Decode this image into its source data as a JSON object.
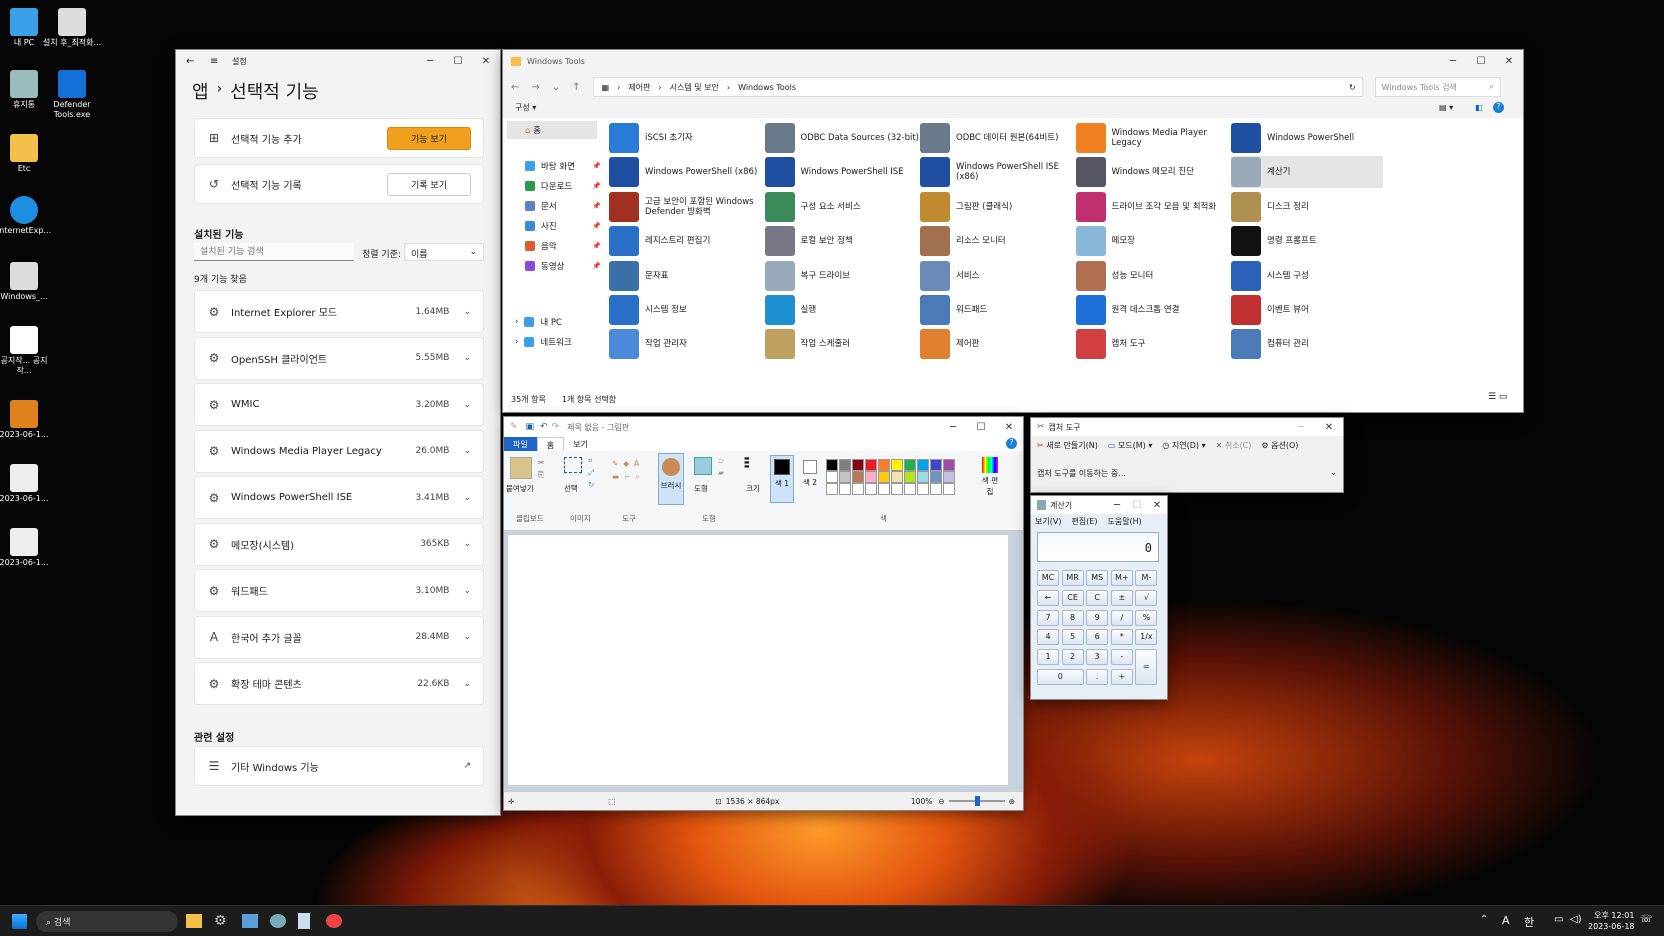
{
  "desktop": {
    "icons": [
      "내 PC",
      "설치 후_최적화...",
      "휴지통",
      "Defender Tools.exe",
      "Etc",
      "InternetExp...",
      "Windows_...",
      "공지작... 공지작...",
      "2023-06-1...",
      "2023-06-1...",
      "2023-06-1..."
    ]
  },
  "settings": {
    "title": "설정",
    "crumb_parent": "앱",
    "crumb_sep": "›",
    "crumb_current": "선택적 기능",
    "add_label": "선택적 기능 추가",
    "add_btn": "기능 보기",
    "history_label": "선택적 기능 기록",
    "history_btn": "기록 보기",
    "installed_heading": "설치된 기능",
    "search_placeholder": "설치된 기능 검색",
    "sort_label": "정렬 기준:",
    "sort_value": "이름",
    "found": "9개 기능 찾음",
    "features": [
      {
        "name": "Internet Explorer 모드",
        "size": "1.64MB"
      },
      {
        "name": "OpenSSH 클라이언트",
        "size": "5.55MB"
      },
      {
        "name": "WMIC",
        "size": "3.20MB"
      },
      {
        "name": "Windows Media Player Legacy",
        "size": "26.0MB"
      },
      {
        "name": "Windows PowerShell ISE",
        "size": "3.41MB"
      },
      {
        "name": "메모장(시스템)",
        "size": "365KB"
      },
      {
        "name": "워드패드",
        "size": "3.10MB"
      },
      {
        "name": "한국어 추가 글꼴",
        "size": "28.4MB"
      },
      {
        "name": "확장 테마 콘텐츠",
        "size": "22.6KB"
      }
    ],
    "related_heading": "관련 설정",
    "related_item": "기타 Windows 기능"
  },
  "explorer": {
    "title": "Windows Tools",
    "path": [
      "제어판",
      "시스템 및 보안",
      "Windows Tools"
    ],
    "search_placeholder": "Windows Tools 검색",
    "organize": "구성 ▾",
    "nav_home": "홈",
    "nav": [
      "바탕 화면",
      "다운로드",
      "문서",
      "사진",
      "음악",
      "동영상"
    ],
    "nav_pc": "내 PC",
    "nav_net": "네트워크",
    "tools": [
      "iSCSI 초기자",
      "ODBC Data Sources (32-bit)",
      "ODBC 데이터 원본(64비트)",
      "Windows Media Player Legacy",
      "Windows PowerShell",
      "Windows PowerShell (x86)",
      "Windows PowerShell ISE",
      "Windows PowerShell ISE (x86)",
      "Windows 메모리 진단",
      "계산기",
      "고급 보안이 포함된 Windows Defender 방화벽",
      "구성 요소 서비스",
      "그림판 (클래식)",
      "드라이브 조각 모음 및 최적화",
      "디스크 정리",
      "레지스트리 편집기",
      "로컬 보안 정책",
      "리소스 모니터",
      "메모장",
      "명령 프롬프트",
      "문자표",
      "복구 드라이브",
      "서비스",
      "성능 모니터",
      "시스템 구성",
      "시스템 정보",
      "실행",
      "워드패드",
      "원격 데스크톱 연결",
      "이벤트 뷰어",
      "작업 관리자",
      "작업 스케줄러",
      "제어판",
      "캡처 도구",
      "컴퓨터 관리"
    ],
    "status_count": "35개 항목",
    "status_sel": "1개 항목 선택함"
  },
  "paint": {
    "title": "제목 없음 - 그림판",
    "tabs": [
      "파일",
      "홈",
      "보기"
    ],
    "groups": [
      "클립보드",
      "이미지",
      "도구",
      "도형",
      "색"
    ],
    "paste": "붙여넣기",
    "select": "선택",
    "brush": "브러시",
    "shapes": "도형",
    "size": "크기",
    "color1": "색 1",
    "color2": "색 2",
    "edit_colors": "색 편집",
    "dims": "1536 × 864px",
    "zoom": "100%",
    "palette": [
      "#000000",
      "#7f7f7f",
      "#880015",
      "#ed1c24",
      "#ff7f27",
      "#fff200",
      "#22b14c",
      "#00a2e8",
      "#3f48cc",
      "#a349a4",
      "#ffffff",
      "#c3c3c3",
      "#b97a57",
      "#ffaec9",
      "#ffc90e",
      "#efe4b0",
      "#b5e61d",
      "#99d9ea",
      "#7092be",
      "#c8bfe7"
    ]
  },
  "snip": {
    "title": "캡처 도구",
    "new": "새로 만들기(N)",
    "mode": "모드(M)",
    "delay": "지연(D)",
    "cancel": "취소(C)",
    "options": "옵션(O)",
    "status": "캡처 도구를 이동하는 중..."
  },
  "calc": {
    "title": "계산기",
    "menu": [
      "보기(V)",
      "편집(E)",
      "도움말(H)"
    ],
    "display": "0",
    "keys": [
      "MC",
      "MR",
      "MS",
      "M+",
      "M-",
      "←",
      "CE",
      "C",
      "±",
      "√",
      "7",
      "8",
      "9",
      "/",
      "%",
      "4",
      "5",
      "6",
      "*",
      "1/x",
      "1",
      "2",
      "3",
      "-",
      "=",
      "0",
      ".",
      "+"
    ]
  },
  "taskbar": {
    "search": "검색",
    "ime": "A",
    "lang": "한",
    "time": "오후 12:01",
    "date": "2023-06-18"
  }
}
